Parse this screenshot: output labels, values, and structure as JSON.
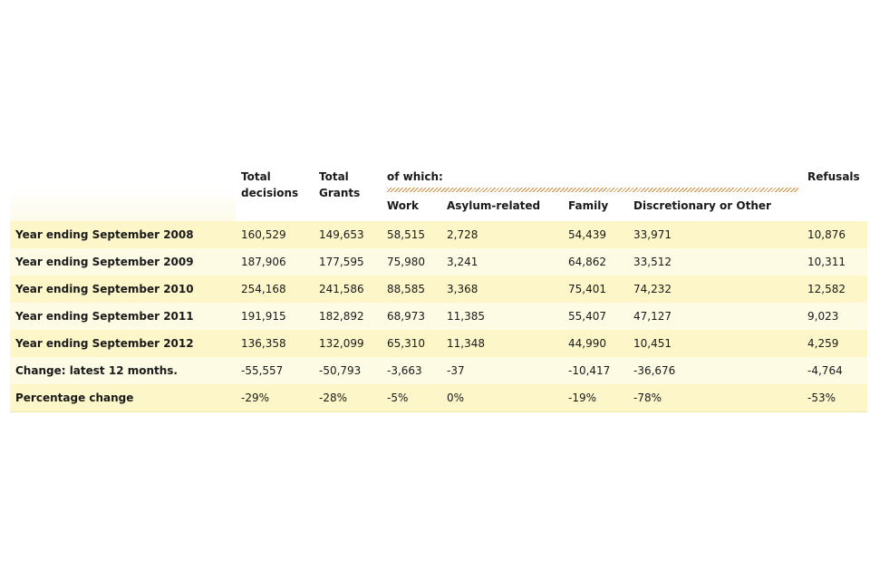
{
  "table": {
    "header": {
      "total_decisions_line1": "Total",
      "total_decisions_line2": "decisions",
      "total_grants_line1": "Total",
      "total_grants_line2": "Grants",
      "of_which": "of which:",
      "refusals": "Refusals",
      "work": "Work",
      "asylum": "Asylum-related",
      "family": "Family",
      "discretionary": "Discretionary or Other"
    },
    "rows": [
      {
        "label": "Year ending September 2008",
        "total": "160,529",
        "grants": "149,653",
        "work": "58,515",
        "asylum": "2,728",
        "family": "54,439",
        "disc": "33,971",
        "refusals": "10,876"
      },
      {
        "label": "Year ending September 2009",
        "total": "187,906",
        "grants": "177,595",
        "work": "75,980",
        "asylum": "3,241",
        "family": "64,862",
        "disc": "33,512",
        "refusals": "10,311"
      },
      {
        "label": "Year ending September 2010",
        "total": "254,168",
        "grants": "241,586",
        "work": "88,585",
        "asylum": "3,368",
        "family": "75,401",
        "disc": "74,232",
        "refusals": "12,582"
      },
      {
        "label": "Year ending September 2011",
        "total": "191,915",
        "grants": "182,892",
        "work": "68,973",
        "asylum": "11,385",
        "family": "55,407",
        "disc": "47,127",
        "refusals": "9,023"
      },
      {
        "label": "Year ending September 2012",
        "total": "136,358",
        "grants": "132,099",
        "work": "65,310",
        "asylum": "11,348",
        "family": "44,990",
        "disc": "10,451",
        "refusals": "4,259"
      },
      {
        "label": "Change: latest 12 months.",
        "total": "-55,557",
        "grants": "-50,793",
        "work": "-3,663",
        "asylum": "-37",
        "family": "-10,417",
        "disc": "-36,676",
        "refusals": "-4,764"
      },
      {
        "label": "Percentage change",
        "total": "-29%",
        "grants": "-28%",
        "work": "-5%",
        "asylum": "0%",
        "family": "-19%",
        "disc": "-78%",
        "refusals": "-53%"
      }
    ]
  }
}
